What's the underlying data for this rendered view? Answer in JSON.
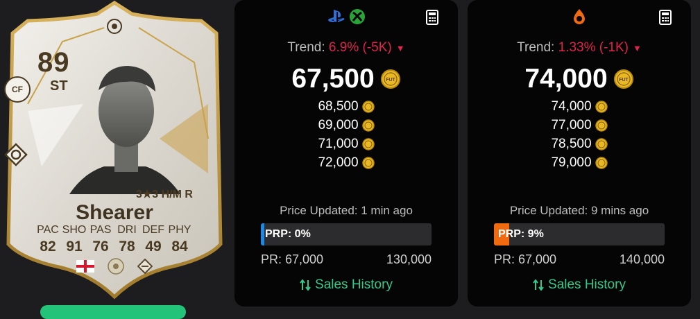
{
  "card": {
    "rating": "89",
    "position": "ST",
    "alt_position": "CF",
    "skills_text": "3★3 H/M R",
    "name": "Shearer",
    "stat_labels": [
      "PAC",
      "SHO",
      "PAS",
      "DRI",
      "DEF",
      "PHY"
    ],
    "stat_values": [
      "82",
      "91",
      "76",
      "78",
      "49",
      "84"
    ]
  },
  "panels": [
    {
      "platform_icons": [
        "playstation-icon",
        "xbox-icon"
      ],
      "trend_label": "Trend:",
      "trend_value": "6.9% (-5K)",
      "main_price": "67,500",
      "prices": [
        "68,500",
        "69,000",
        "71,000",
        "72,000"
      ],
      "updated": "Price Updated: 1 min ago",
      "prp_label": "PRP: 0%",
      "prp_percent": 0,
      "prp_color": "#1e88e5",
      "range_min": "PR: 67,000",
      "range_max": "130,000",
      "sales_label": "Sales History"
    },
    {
      "platform_icons": [
        "origin-icon"
      ],
      "trend_label": "Trend:",
      "trend_value": "1.33% (-1K)",
      "main_price": "74,000",
      "prices": [
        "74,000",
        "77,000",
        "78,500",
        "79,000"
      ],
      "updated": "Price Updated: 9 mins ago",
      "prp_label": "PRP: 9%",
      "prp_percent": 9,
      "prp_color": "#f06a10",
      "range_min": "PR: 67,000",
      "range_max": "140,000",
      "sales_label": "Sales History"
    }
  ],
  "colors": {
    "trend_negative": "#e0244e",
    "sales_link": "#36c98c",
    "coin_gold": "#e8b827",
    "panel_bg": "#050505"
  }
}
